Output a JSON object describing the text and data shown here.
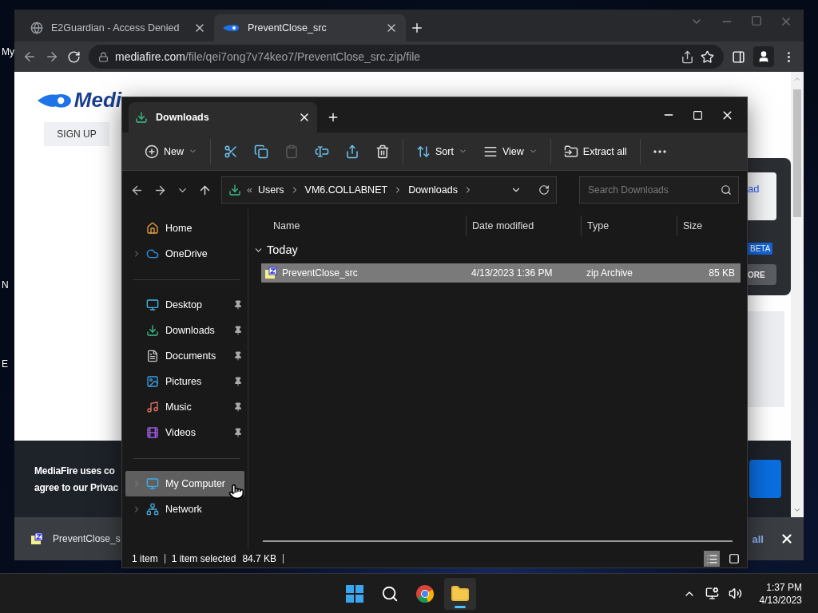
{
  "desktop": {
    "icon_labels": [
      "My",
      "N",
      "E"
    ]
  },
  "browser": {
    "tabs": [
      {
        "title": "E2Guardian - Access Denied",
        "kind": "globe",
        "selected": false
      },
      {
        "title": "PreventClose_src",
        "kind": "flame",
        "selected": true
      }
    ],
    "address": {
      "domain": "mediafire.com",
      "path": "/file/qei7ong7v74keo7/PreventClose_src.zip/file"
    },
    "page": {
      "logo_text": "Medi",
      "sign_up": "SIGN UP",
      "side_button": "ad",
      "badge": "BETA",
      "more_button": "ORE",
      "cookie_lines": [
        "MediaFire uses co",
        "agree to our Privac"
      ]
    },
    "download_bar": {
      "file": "PreventClose_s",
      "show_all": "all"
    }
  },
  "explorer": {
    "tab": {
      "title": "Downloads"
    },
    "toolbar": [
      [
        {
          "kind": "new",
          "label": "New",
          "menu": true,
          "disabled": false
        }
      ],
      [
        {
          "kind": "cut",
          "menu": false,
          "disabled": false
        },
        {
          "kind": "copy",
          "menu": false,
          "disabled": false
        },
        {
          "kind": "paste",
          "menu": false,
          "disabled": true
        },
        {
          "kind": "rename",
          "menu": false,
          "disabled": false
        },
        {
          "kind": "share",
          "menu": false,
          "disabled": false
        },
        {
          "kind": "delete",
          "menu": false,
          "disabled": false
        }
      ],
      [
        {
          "kind": "sort",
          "label": "Sort",
          "menu": true,
          "disabled": false
        },
        {
          "kind": "view",
          "label": "View",
          "menu": true,
          "disabled": false
        }
      ],
      [
        {
          "kind": "extract",
          "label": "Extract all",
          "menu": false,
          "disabled": false
        }
      ],
      [
        {
          "kind": "more",
          "menu": false,
          "disabled": false
        }
      ]
    ],
    "breadcrumb": {
      "overflow_mark": "«",
      "parts": [
        "Users",
        "VM6.COLLABNET",
        "Downloads"
      ]
    },
    "search": {
      "placeholder": "Search Downloads"
    },
    "nav": [
      [
        {
          "label": "Home",
          "kind": "home",
          "expandable": false,
          "pinned": false,
          "selected": false
        },
        {
          "label": "OneDrive",
          "kind": "cloud",
          "expandable": true,
          "pinned": false,
          "selected": false
        }
      ],
      [
        {
          "label": "Desktop",
          "kind": "desktop",
          "expandable": false,
          "pinned": true,
          "selected": false
        },
        {
          "label": "Downloads",
          "kind": "download",
          "expandable": false,
          "pinned": true,
          "selected": false
        },
        {
          "label": "Documents",
          "kind": "document",
          "expandable": false,
          "pinned": true,
          "selected": false
        },
        {
          "label": "Pictures",
          "kind": "picture",
          "expandable": false,
          "pinned": true,
          "selected": false
        },
        {
          "label": "Music",
          "kind": "music",
          "expandable": false,
          "pinned": true,
          "selected": false
        },
        {
          "label": "Videos",
          "kind": "video",
          "expandable": false,
          "pinned": true,
          "selected": false
        }
      ],
      [
        {
          "label": "My Computer",
          "kind": "computer",
          "expandable": true,
          "pinned": false,
          "selected": true
        },
        {
          "label": "Network",
          "kind": "network",
          "expandable": true,
          "pinned": false,
          "selected": false
        }
      ]
    ],
    "columns": [
      "Name",
      "Date modified",
      "Type",
      "Size"
    ],
    "groups": [
      {
        "label": "Today",
        "expanded": true,
        "rows": [
          {
            "name": "PreventClose_src",
            "date": "4/13/2023 1:36 PM",
            "type": "zip Archive",
            "size": "85 KB",
            "selected": true
          }
        ]
      }
    ],
    "status": {
      "count": "1 item",
      "selection": "1 item selected",
      "size": "84.7 KB"
    },
    "view_toggles": [
      {
        "kind": "details",
        "selected": true
      },
      {
        "kind": "tiles",
        "selected": false
      }
    ]
  },
  "taskbar": {
    "apps": [
      {
        "kind": "start",
        "active": false
      },
      {
        "kind": "search",
        "active": false
      },
      {
        "kind": "chrome",
        "active": false
      },
      {
        "kind": "explorer",
        "active": true
      }
    ],
    "time": "1:37 PM",
    "date": "4/13/2023"
  }
}
